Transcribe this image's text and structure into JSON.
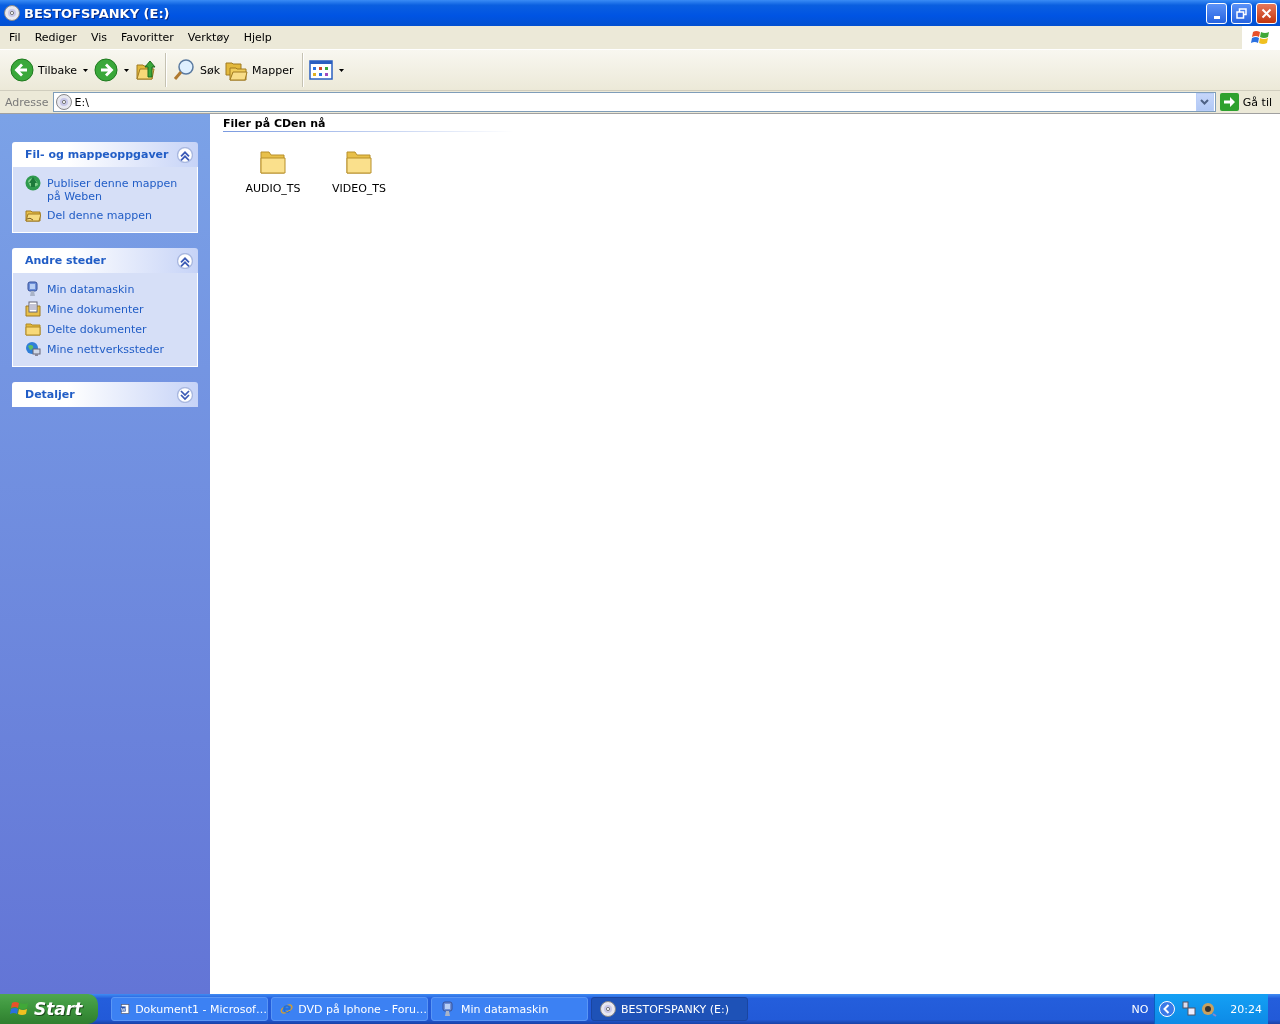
{
  "window": {
    "title": "BESTOFSPANKY (E:)"
  },
  "menu": [
    "Fil",
    "Rediger",
    "Vis",
    "Favoritter",
    "Verktøy",
    "Hjelp"
  ],
  "toolbar": [
    {
      "kind": "back",
      "label": "Tilbake"
    },
    {
      "kind": "forward"
    },
    {
      "kind": "up"
    },
    {
      "kind": "search",
      "label": "Søk"
    },
    {
      "kind": "folders",
      "label": "Mapper"
    },
    {
      "kind": "views"
    }
  ],
  "address": {
    "label": "Adresse",
    "value": "E:\\",
    "go": "Gå til"
  },
  "task_panels": [
    {
      "title": "Fil- og mappeoppgaver",
      "expanded": true,
      "items": [
        {
          "kind": "globe",
          "label": "Publiser denne mappen på Weben"
        },
        {
          "kind": "share",
          "label": "Del denne mappen"
        }
      ]
    },
    {
      "title": "Andre steder",
      "expanded": true,
      "items": [
        {
          "kind": "computer",
          "label": "Min datamaskin"
        },
        {
          "kind": "documents",
          "label": "Mine dokumenter"
        },
        {
          "kind": "folder",
          "label": "Delte dokumenter"
        },
        {
          "kind": "network",
          "label": "Mine nettverkssteder"
        }
      ]
    },
    {
      "title": "Detaljer",
      "expanded": false
    }
  ],
  "files": {
    "heading": "Filer på CDen nå",
    "items": [
      {
        "name": "AUDIO_TS"
      },
      {
        "name": "VIDEO_TS"
      }
    ]
  },
  "taskbar": {
    "start": "Start",
    "tasks": [
      {
        "kind": "word",
        "label": "Dokument1 - Microsof…",
        "selected": false
      },
      {
        "kind": "browser",
        "label": "DVD på Iphone - Foru…",
        "selected": false
      },
      {
        "kind": "computer",
        "label": "Min datamaskin",
        "selected": false
      },
      {
        "kind": "cd",
        "label": "BESTOFSPANKY (E:)",
        "selected": true
      }
    ],
    "language": "NO",
    "clock": "20:24"
  }
}
